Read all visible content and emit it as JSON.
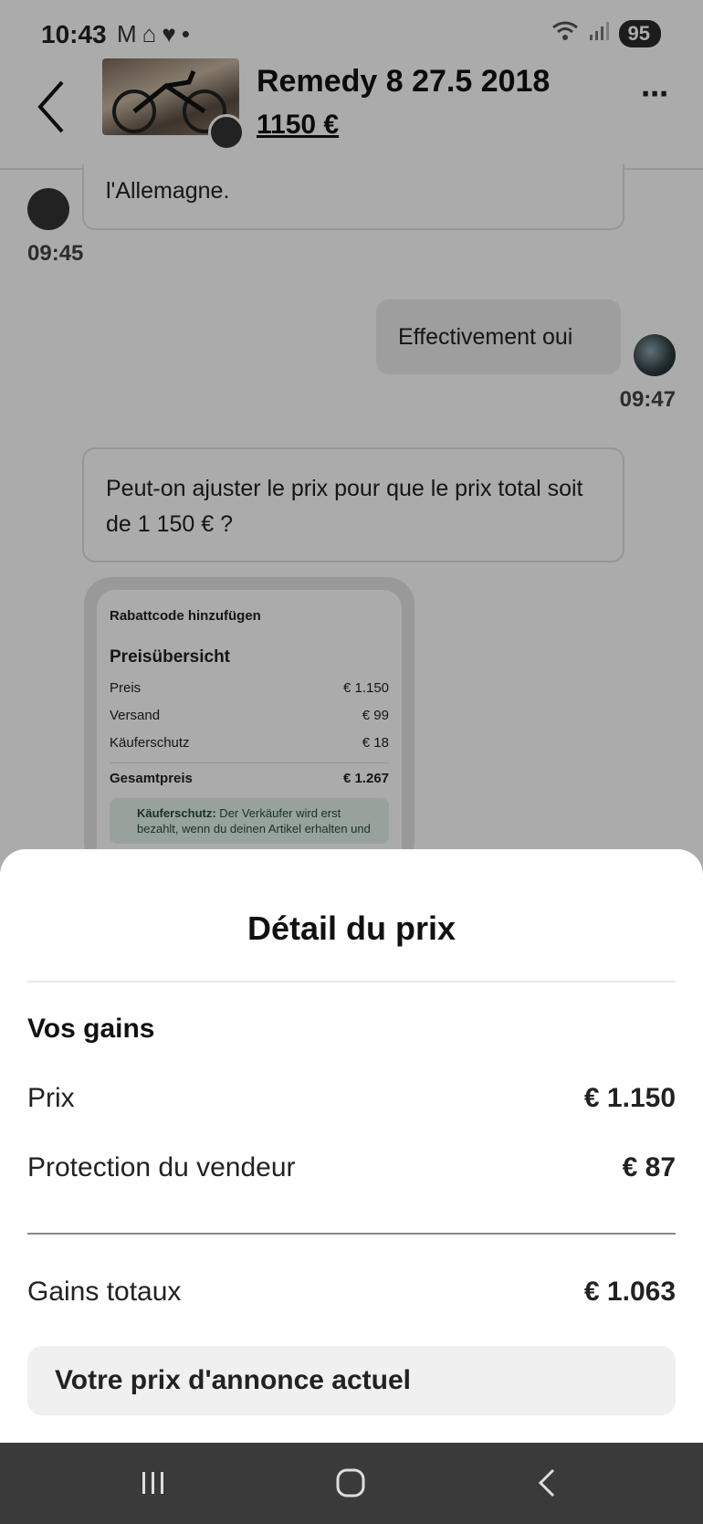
{
  "status_bar": {
    "time": "10:43",
    "left_icons": [
      "gmail-icon",
      "airbnb-icon",
      "heart-icon",
      "dot-icon"
    ],
    "right_icons": [
      "wifi-icon",
      "signal-icon"
    ],
    "battery": "95"
  },
  "header": {
    "title": "Remedy 8 27.5 2018",
    "price": "1150 €",
    "more_label": "⋯"
  },
  "messages": [
    {
      "text": "l'Allemagne.",
      "time": "09:45",
      "sender": "other"
    },
    {
      "text": "Effectivement oui",
      "time": "09:47",
      "sender": "me"
    },
    {
      "text": "Peut-on ajuster le prix pour que le prix total soit de 1 150 € ?",
      "sender": "other"
    }
  ],
  "screenshot": {
    "discount": "Rabattcode hinzufügen",
    "heading": "Preisübersicht",
    "rows": [
      {
        "label": "Preis",
        "value": "€ 1.150"
      },
      {
        "label": "Versand",
        "value": "€ 99"
      },
      {
        "label": "Käuferschutz",
        "value": "€ 18"
      }
    ],
    "total": {
      "label": "Gesamtpreis",
      "value": "€ 1.267"
    },
    "note_bold": "Käuferschutz:",
    "note_text": " Der Verkäufer wird erst bezahlt, wenn du deinen Artikel erhalten und"
  },
  "sheet": {
    "title": "Détail du prix",
    "section": "Vos gains",
    "rows": [
      {
        "label": "Prix",
        "value": "€ 1.150"
      },
      {
        "label": "Protection du vendeur",
        "value": "€ 87"
      }
    ],
    "total": {
      "label": "Gains totaux",
      "value": "€ 1.063"
    },
    "button": "Votre prix d'annonce actuel"
  },
  "nav": [
    "recent-apps-icon",
    "home-icon",
    "back-icon"
  ]
}
